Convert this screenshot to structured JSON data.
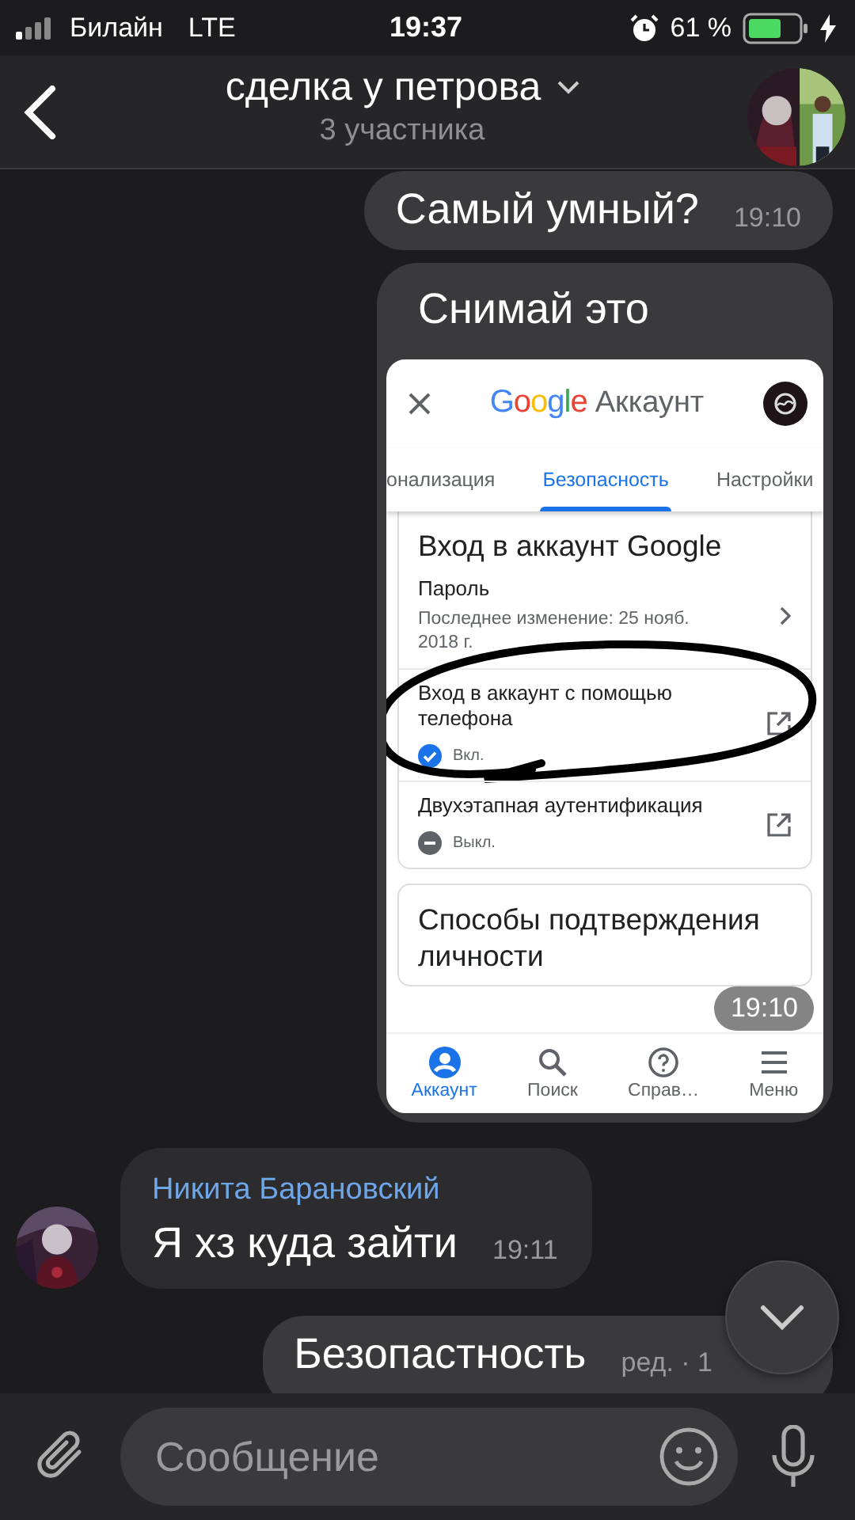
{
  "status_bar": {
    "carrier": "Билайн",
    "network": "LTE",
    "time": "19:37",
    "battery_text": "61 %"
  },
  "header": {
    "title": "сделка у петрова",
    "subtitle": "3 участника"
  },
  "messages": [
    {
      "kind": "text",
      "outgoing": true,
      "text": "Самый умный?",
      "time": "19:10"
    },
    {
      "outgoing": true,
      "caption": "Снимай это",
      "time": "19:10",
      "embedded": {
        "brand": "Google",
        "title": "Аккаунт",
        "tabs": [
          {
            "label": "онализация",
            "selected": false
          },
          {
            "label": "Безопасность",
            "selected": true
          },
          {
            "label": "Настройки",
            "selected": false
          }
        ],
        "cards": [
          {
            "title": "Вход в аккаунт Google",
            "items": [
              {
                "kind": "link",
                "label": "Пароль",
                "detail": "Последнее изменение: 25 нояб. 2018 г."
              },
              {
                "kind": "external",
                "label": "Вход в аккаунт с помощью телефона",
                "status": "Вкл.",
                "on": true
              },
              {
                "kind": "external",
                "label": "Двухэтапная аутентификация",
                "status": "Выкл.",
                "on": false
              }
            ]
          },
          {
            "title": "Способы подтверждения личности"
          }
        ],
        "nav": [
          {
            "label": "Аккаунт",
            "selected": true
          },
          {
            "label": "Поиск",
            "selected": false
          },
          {
            "label": "Справ…",
            "selected": false
          },
          {
            "label": "Меню",
            "selected": false
          }
        ]
      }
    },
    {
      "kind": "text",
      "outgoing": false,
      "sender": "Никита Барановский",
      "text": "Я хз куда зайти",
      "time": "19:11"
    },
    {
      "kind": "text",
      "outgoing": true,
      "text": "Безопастность",
      "time": "ред. · 1"
    }
  ],
  "composer": {
    "placeholder": "Сообщение"
  }
}
